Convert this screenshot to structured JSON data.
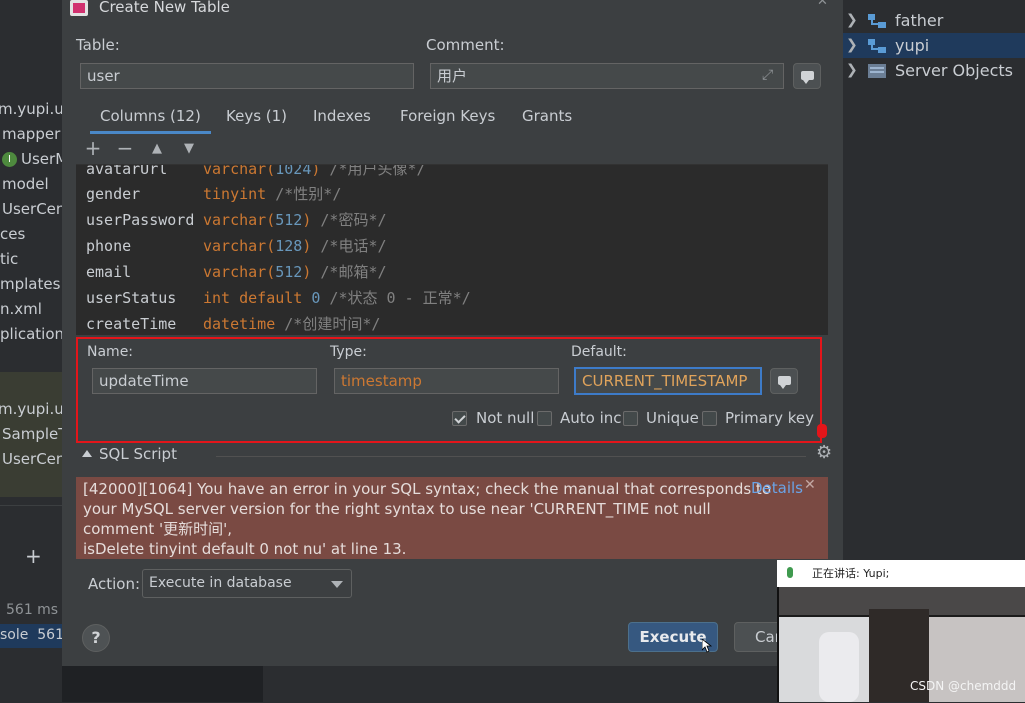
{
  "dialog": {
    "title": "Create New Table",
    "table_label": "Table:",
    "table_value": "user",
    "comment_label": "Comment:",
    "comment_value": "用户",
    "tabs": [
      {
        "label": "Columns (12)",
        "active": true
      },
      {
        "label": "Keys (1)",
        "active": false
      },
      {
        "label": "Indexes",
        "active": false
      },
      {
        "label": "Foreign Keys",
        "active": false
      },
      {
        "label": "Grants",
        "active": false
      }
    ],
    "toolbar": {
      "add": "+",
      "remove": "−",
      "up": "▲",
      "down": "▼"
    },
    "columns": [
      {
        "name": "avatarUrl",
        "type": "varchar(",
        "num": "1024",
        "rest": ")",
        "comment": " /*用户头像*/"
      },
      {
        "name": "gender",
        "type": "tinyint",
        "num": "",
        "rest": "",
        "comment": " /*性别*/"
      },
      {
        "name": "userPassword",
        "type": "varchar(",
        "num": "512",
        "rest": ")",
        "comment": " /*密码*/"
      },
      {
        "name": "phone",
        "type": "varchar(",
        "num": "128",
        "rest": ")",
        "comment": " /*电话*/"
      },
      {
        "name": "email",
        "type": "varchar(",
        "num": "512",
        "rest": ")",
        "comment": " /*邮箱*/"
      },
      {
        "name": "userStatus",
        "type": "int default ",
        "num": "0",
        "rest": "",
        "comment": " /*状态 0 - 正常*/"
      },
      {
        "name": "createTime",
        "type": "datetime",
        "num": "",
        "rest": "",
        "comment": " /*创建时间*/"
      }
    ],
    "detail": {
      "name_label": "Name:",
      "name_value": "updateTime",
      "type_label": "Type:",
      "type_value": "timestamp",
      "default_label": "Default:",
      "default_value": "CURRENT_TIMESTAMP",
      "checks": {
        "not_null": {
          "label": "Not null",
          "checked": true
        },
        "auto_inc": {
          "label": "Auto inc",
          "checked": false
        },
        "unique": {
          "label": "Unique",
          "checked": false
        },
        "primary_key": {
          "label": "Primary key",
          "checked": false
        }
      }
    },
    "sql_script_label": "SQL Script",
    "error": {
      "lines": [
        "[42000][1064] You have an error in your SQL syntax; check the manual that corresponds to",
        "your MySQL server version for the right syntax to use near 'CURRENT_TIME not null",
        "comment '更新时间',",
        "isDelete tinyint default 0 not nu' at line 13."
      ],
      "details_link": "Details",
      "close": "✕"
    },
    "action_label": "Action:",
    "action_value": "Execute in database",
    "help": "?",
    "execute_label": "Execute",
    "cancel_label": "Cancel"
  },
  "right_tree": [
    {
      "label": "father",
      "selected": false
    },
    {
      "label": "yupi",
      "selected": true
    },
    {
      "label": "Server Objects",
      "selected": false
    }
  ],
  "left_panel": {
    "rows": [
      "m.yupi.us",
      "mapper",
      "UserM",
      "model",
      "UserCen",
      "ces",
      "tic",
      "mplates",
      "n.xml",
      "plication.",
      "m.yupi.us",
      "SampleT",
      "UserCen"
    ],
    "bottom": [
      "561 ms",
      "sole  561"
    ]
  },
  "video": {
    "speaking": "正在讲话: Yupi;",
    "watermark": "CSDN @chemddd"
  },
  "colors": {
    "accent": "#365880",
    "error_bg": "#7a4a43",
    "highlight_box": "#e3151a",
    "keyword": "#cc7832",
    "number": "#6897bb"
  }
}
